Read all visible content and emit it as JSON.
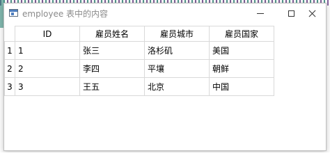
{
  "window": {
    "title": "employee 表中的内容"
  },
  "table": {
    "columns": [
      "ID",
      "雇员姓名",
      "雇员城市",
      "雇员国家"
    ],
    "rows": [
      {
        "header": "1",
        "cells": [
          "1",
          "张三",
          "洛杉矶",
          "美国"
        ]
      },
      {
        "header": "2",
        "cells": [
          "2",
          "李四",
          "平壤",
          "朝鲜"
        ]
      },
      {
        "header": "3",
        "cells": [
          "3",
          "王五",
          "北京",
          "中国"
        ]
      }
    ]
  },
  "icons": {
    "app": "window-app-icon",
    "minimize": "minimize-icon",
    "maximize": "maximize-icon",
    "close": "close-icon"
  }
}
